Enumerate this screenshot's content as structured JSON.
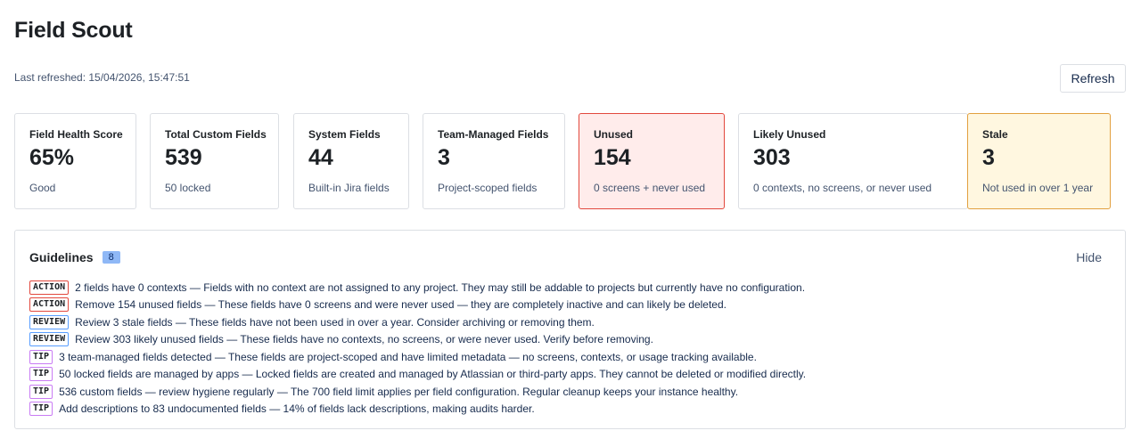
{
  "app": {
    "title": "Field Scout",
    "last_refreshed": "Last refreshed: 15/04/2026, 15:47:51",
    "refresh_label": "Refresh"
  },
  "cards": [
    {
      "label": "Field Health Score",
      "value": "65%",
      "sub": "Good",
      "style": "normal"
    },
    {
      "label": "Total Custom Fields",
      "value": "539",
      "sub": "50 locked",
      "style": "normal"
    },
    {
      "label": "System Fields",
      "value": "44",
      "sub": "Built-in Jira fields",
      "style": "normal"
    },
    {
      "label": "Team-Managed Fields",
      "value": "3",
      "sub": "Project-scoped fields",
      "style": "normal"
    },
    {
      "label": "Unused",
      "value": "154",
      "sub": "0 screens + never used",
      "style": "danger"
    },
    {
      "label": "Likely Unused",
      "value": "303",
      "sub": "0 contexts, no screens, or never used",
      "style": "normal"
    },
    {
      "label": "Stale",
      "value": "3",
      "sub": "Not used in over 1 year",
      "style": "warning"
    }
  ],
  "guidelines": {
    "title": "Guidelines",
    "count": "8",
    "hide_label": "Hide",
    "items": [
      {
        "tag": "ACTION",
        "kind": "action",
        "text": "2 fields have 0 contexts — Fields with no context are not assigned to any project. They may still be addable to projects but currently have no configuration."
      },
      {
        "tag": "ACTION",
        "kind": "action",
        "text": "Remove 154 unused fields — These fields have 0 screens and were never used — they are completely inactive and can likely be deleted."
      },
      {
        "tag": "REVIEW",
        "kind": "review",
        "text": "Review 3 stale fields — These fields have not been used in over a year. Consider archiving or removing them."
      },
      {
        "tag": "REVIEW",
        "kind": "review",
        "text": "Review 303 likely unused fields — These fields have no contexts, no screens, or were never used. Verify before removing."
      },
      {
        "tag": "TIP",
        "kind": "tip",
        "text": "3 team-managed fields detected — These fields are project-scoped and have limited metadata — no screens, contexts, or usage tracking available."
      },
      {
        "tag": "TIP",
        "kind": "tip",
        "text": "50 locked fields are managed by apps — Locked fields are created and managed by Atlassian or third-party apps. They cannot be deleted or modified directly."
      },
      {
        "tag": "TIP",
        "kind": "tip",
        "text": "536 custom fields — review hygiene regularly — The 700 field limit applies per field configuration. Regular cleanup keeps your instance healthy."
      },
      {
        "tag": "TIP",
        "kind": "tip",
        "text": "Add descriptions to 83 undocumented fields — 14% of fields lack descriptions, making audits harder."
      }
    ]
  },
  "colors": {
    "danger_bg": "#ffeceb",
    "danger_border": "#e2483d",
    "warning_bg": "#fff7e0",
    "warning_border": "#e2a03f",
    "badge_bg": "#8fb8f6"
  }
}
